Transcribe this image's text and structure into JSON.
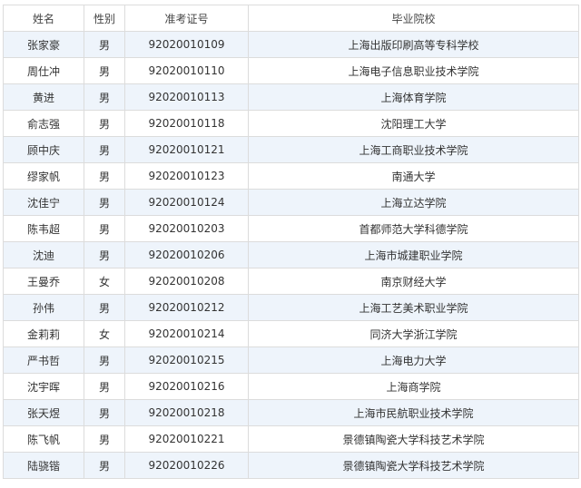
{
  "table": {
    "headers": [
      "姓名",
      "性别",
      "准考证号",
      "毕业院校"
    ],
    "rows": [
      [
        "张家豪",
        "男",
        "92020010109",
        "上海出版印刷高等专科学校"
      ],
      [
        "周仕冲",
        "男",
        "92020010110",
        "上海电子信息职业技术学院"
      ],
      [
        "黄进",
        "男",
        "92020010113",
        "上海体育学院"
      ],
      [
        "俞志强",
        "男",
        "92020010118",
        "沈阳理工大学"
      ],
      [
        "顾中庆",
        "男",
        "92020010121",
        "上海工商职业技术学院"
      ],
      [
        "缪家帆",
        "男",
        "92020010123",
        "南通大学"
      ],
      [
        "沈佳宁",
        "男",
        "92020010124",
        "上海立达学院"
      ],
      [
        "陈韦超",
        "男",
        "92020010203",
        "首都师范大学科德学院"
      ],
      [
        "沈迪",
        "男",
        "92020010206",
        "上海市城建职业学院"
      ],
      [
        "王曼乔",
        "女",
        "92020010208",
        "南京财经大学"
      ],
      [
        "孙伟",
        "男",
        "92020010212",
        "上海工艺美术职业学院"
      ],
      [
        "金莉莉",
        "女",
        "92020010214",
        "同济大学浙江学院"
      ],
      [
        "严书哲",
        "男",
        "92020010215",
        "上海电力大学"
      ],
      [
        "沈宇晖",
        "男",
        "92020010216",
        "上海商学院"
      ],
      [
        "张天煜",
        "男",
        "92020010218",
        "上海市民航职业技术学院"
      ],
      [
        "陈飞帆",
        "男",
        "92020010221",
        "景德镇陶瓷大学科技艺术学院"
      ],
      [
        "陆骁锴",
        "男",
        "92020010226",
        "景德镇陶瓷大学科技艺术学院"
      ]
    ]
  }
}
